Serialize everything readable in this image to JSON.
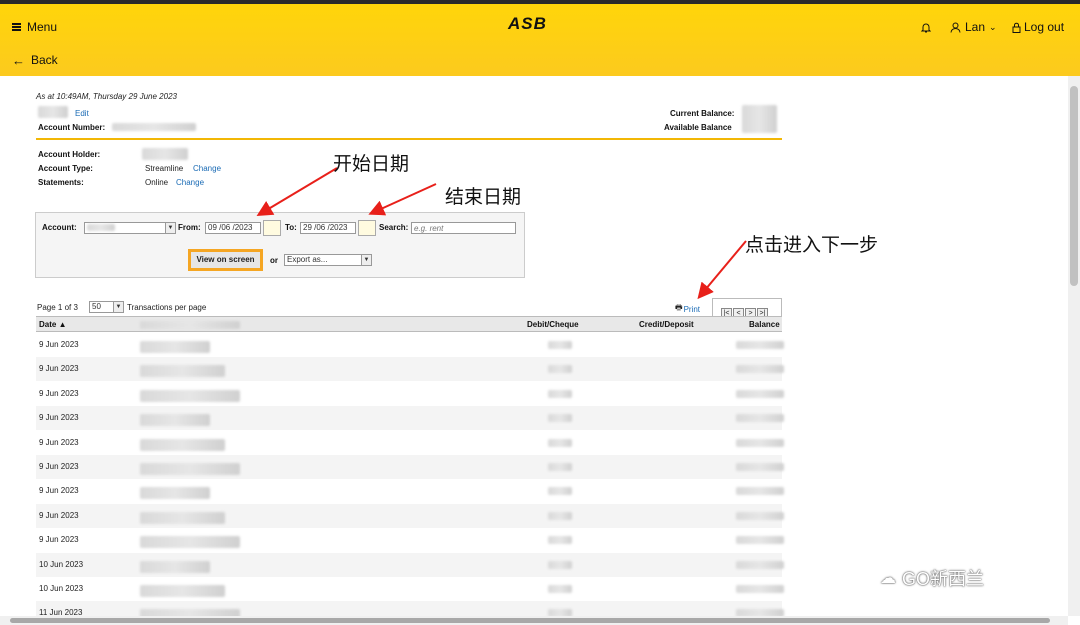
{
  "header": {
    "menu_label": "Menu",
    "back_label": "Back",
    "logo_text": "ASB",
    "user_label": "Lan",
    "logout_label": "Log out",
    "brand_color": "#FFD50A"
  },
  "account": {
    "as_at": "As at 10:49AM, Thursday 29 June 2023",
    "edit_label": "Edit",
    "account_number_label": "Account Number:",
    "current_balance_label": "Current Balance:",
    "available_balance_label": "Available Balance",
    "holder_label": "Account Holder:",
    "type_label": "Account Type:",
    "type_value": "Streamline",
    "type_change": "Change",
    "statements_label": "Statements:",
    "statements_value": "Online",
    "statements_change": "Change"
  },
  "filter": {
    "account_label": "Account:",
    "from_label": "From:",
    "from_value": "09 /06 /2023",
    "to_label": "To:",
    "to_value": "29 /06 /2023",
    "search_label": "Search:",
    "search_placeholder": "e.g. rent",
    "view_button": "View on screen",
    "or_label": "or",
    "export_value": "Export as..."
  },
  "annotations": {
    "start_date": "开始日期",
    "end_date": "结束日期",
    "next_step": "点击进入下一步"
  },
  "table": {
    "page_label": "Page 1 of 3",
    "per_page_value": "50",
    "per_page_label": "Transactions per page",
    "print_label": "Print",
    "columns": {
      "date": "Date ▲",
      "debit": "Debit/Cheque",
      "credit": "Credit/Deposit",
      "balance": "Balance"
    },
    "rows": [
      {
        "date": "9 Jun 2023"
      },
      {
        "date": "9 Jun 2023"
      },
      {
        "date": "9 Jun 2023"
      },
      {
        "date": "9 Jun 2023"
      },
      {
        "date": "9 Jun 2023"
      },
      {
        "date": "9 Jun 2023"
      },
      {
        "date": "9 Jun 2023"
      },
      {
        "date": "9 Jun 2023"
      },
      {
        "date": "9 Jun 2023"
      },
      {
        "date": "10 Jun 2023"
      },
      {
        "date": "10 Jun 2023"
      },
      {
        "date": "11 Jun 2023"
      }
    ]
  },
  "watermark": "GO新西兰"
}
